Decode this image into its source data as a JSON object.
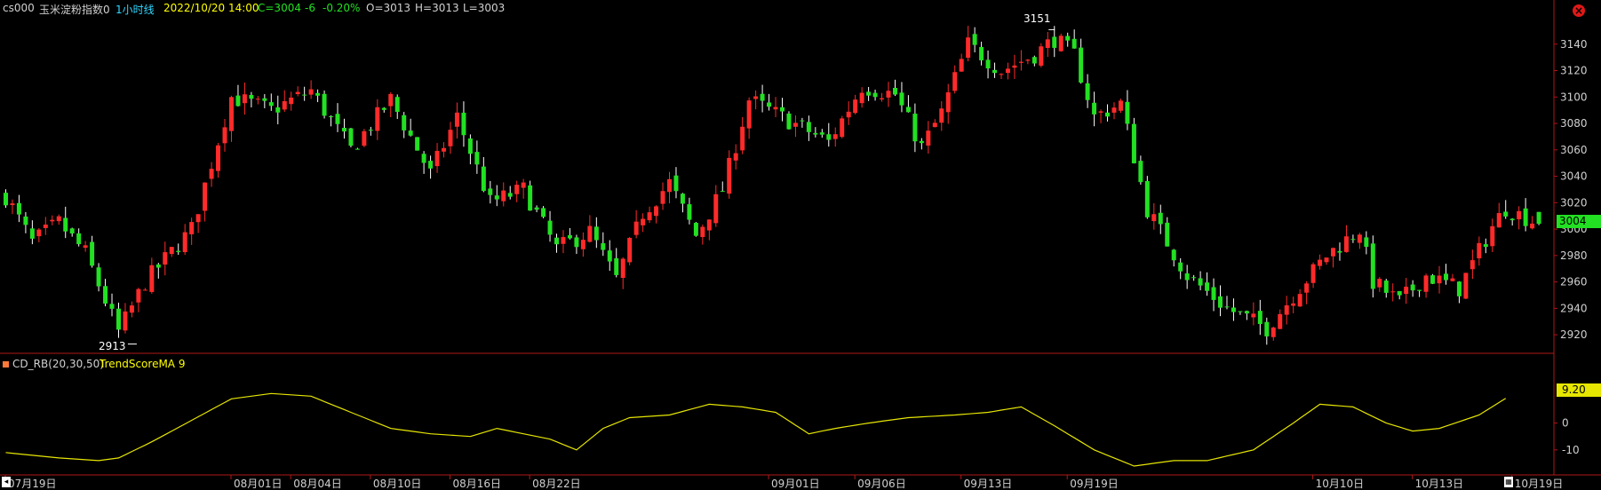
{
  "header": {
    "symbol": "cs000",
    "name": "玉米淀粉指数0",
    "period": "1小时线",
    "datetime": "2022/10/20 14:00",
    "close": "C=3004",
    "change": "-6",
    "change_pct": "-0.20%",
    "open": "O=3013",
    "high": "H=3013",
    "low": "L=3003"
  },
  "indicator": {
    "name": "CD_RB(20,30,50)",
    "series_label": "TrendScoreMA 9",
    "current_value_label": "9.20"
  },
  "current_price_label": "3004",
  "annotations": {
    "high_label": "3151",
    "low_label": "2913"
  },
  "colors": {
    "up": "#ff2a2a",
    "down": "#22e022",
    "ma": "#e6e600",
    "axis": "#b01818",
    "price_tag": "#22e022",
    "ma_tag": "#e6e600"
  },
  "icons": {
    "close": "close-icon",
    "scroll_left": "scroll-left-icon",
    "calendar": "calendar-icon"
  },
  "chart_data": [
    {
      "type": "candlestick",
      "y_ticks": [
        2920,
        2940,
        2960,
        2980,
        3000,
        3020,
        3040,
        3060,
        3080,
        3100,
        3120,
        3140
      ],
      "ylim": [
        2908,
        3160
      ],
      "x_tick_labels": [
        "07月19日",
        "08月01日",
        "08月04日",
        "08月10日",
        "08月16日",
        "08月22日",
        "09月01日",
        "09月06日",
        "09月13日",
        "09月19日",
        "10月10日",
        "10月13日",
        "10月19日"
      ],
      "x_tick_index": [
        0,
        34,
        43,
        55,
        67,
        79,
        115,
        128,
        144,
        160,
        197,
        212,
        227
      ],
      "anchors": [
        [
          0,
          3025
        ],
        [
          4,
          2990
        ],
        [
          8,
          3005
        ],
        [
          12,
          2982
        ],
        [
          17,
          2922
        ],
        [
          21,
          2960
        ],
        [
          28,
          3000
        ],
        [
          34,
          3100
        ],
        [
          40,
          3090
        ],
        [
          46,
          3105
        ],
        [
          52,
          3060
        ],
        [
          58,
          3098
        ],
        [
          64,
          3042
        ],
        [
          68,
          3085
        ],
        [
          73,
          3020
        ],
        [
          78,
          3030
        ],
        [
          83,
          2985
        ],
        [
          88,
          2998
        ],
        [
          92,
          2962
        ],
        [
          96,
          3012
        ],
        [
          100,
          3035
        ],
        [
          104,
          2995
        ],
        [
          108,
          3030
        ],
        [
          112,
          3098
        ],
        [
          118,
          3082
        ],
        [
          124,
          3066
        ],
        [
          129,
          3108
        ],
        [
          134,
          3102
        ],
        [
          138,
          3062
        ],
        [
          141,
          3088
        ],
        [
          145,
          3140
        ],
        [
          150,
          3120
        ],
        [
          155,
          3132
        ],
        [
          158,
          3144
        ],
        [
          161,
          3132
        ],
        [
          164,
          3085
        ],
        [
          168,
          3095
        ],
        [
          172,
          3015
        ],
        [
          178,
          2965
        ],
        [
          184,
          2940
        ],
        [
          190,
          2925
        ],
        [
          194,
          2950
        ],
        [
          199,
          2980
        ],
        [
          204,
          3000
        ],
        [
          206,
          2960
        ],
        [
          210,
          2945
        ],
        [
          214,
          2965
        ],
        [
          219,
          2955
        ],
        [
          224,
          3002
        ],
        [
          226,
          3016
        ],
        [
          231,
          3004
        ]
      ],
      "last": {
        "open": 3013,
        "high": 3013,
        "low": 3003,
        "close": 3004
      },
      "extremes": {
        "high": 3151,
        "low": 2913
      }
    },
    {
      "type": "line",
      "ylim": [
        -17,
        22
      ],
      "y_ticks": [
        -10,
        0
      ],
      "series": [
        {
          "name": "TrendScoreMA 9",
          "points": [
            [
              0,
              -11
            ],
            [
              8,
              -13
            ],
            [
              14,
              -14
            ],
            [
              17,
              -13
            ],
            [
              22,
              -7
            ],
            [
              28,
              1
            ],
            [
              34,
              9
            ],
            [
              40,
              11
            ],
            [
              46,
              10
            ],
            [
              52,
              4
            ],
            [
              58,
              -2
            ],
            [
              64,
              -4
            ],
            [
              70,
              -5
            ],
            [
              74,
              -2
            ],
            [
              78,
              -4
            ],
            [
              82,
              -6
            ],
            [
              86,
              -10
            ],
            [
              90,
              -2
            ],
            [
              94,
              2
            ],
            [
              100,
              3
            ],
            [
              106,
              7
            ],
            [
              111,
              6
            ],
            [
              116,
              4
            ],
            [
              121,
              -4
            ],
            [
              125,
              -2
            ],
            [
              130,
              0
            ],
            [
              136,
              2
            ],
            [
              143,
              3
            ],
            [
              148,
              4
            ],
            [
              153,
              6
            ],
            [
              158,
              -1
            ],
            [
              164,
              -10
            ],
            [
              170,
              -16
            ],
            [
              176,
              -14
            ],
            [
              181,
              -14
            ],
            [
              188,
              -10
            ],
            [
              194,
              0
            ],
            [
              198,
              7
            ],
            [
              203,
              6
            ],
            [
              208,
              0
            ],
            [
              212,
              -3
            ],
            [
              216,
              -2
            ],
            [
              222,
              3
            ],
            [
              226,
              9.2
            ]
          ]
        }
      ],
      "current": 9.2
    }
  ]
}
